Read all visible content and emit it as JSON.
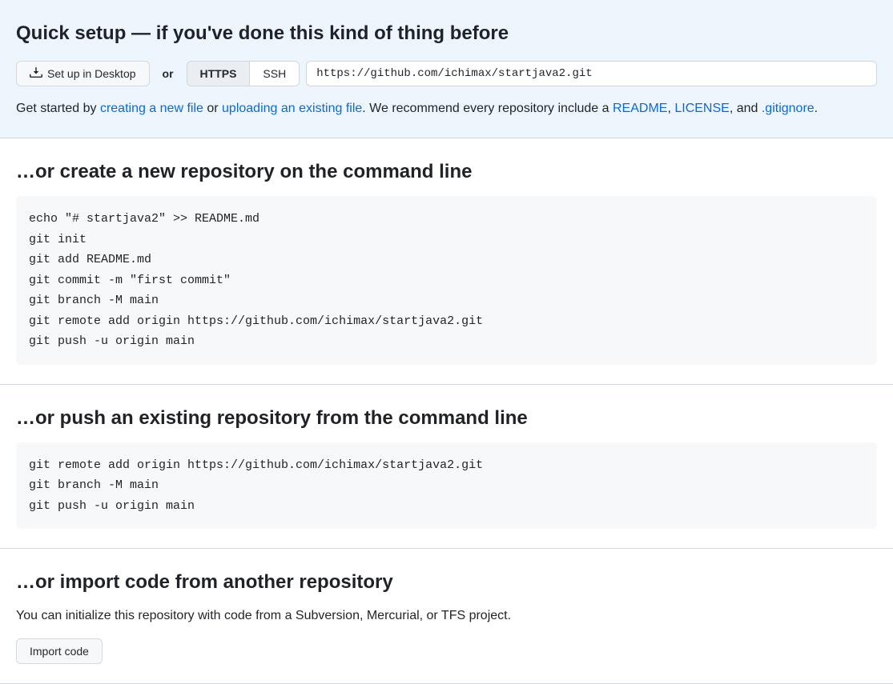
{
  "quickSetup": {
    "title": "Quick setup — if you've done this kind of thing before",
    "desktopBtn": "Set up in Desktop",
    "or": "or",
    "protocols": {
      "https": "HTTPS",
      "ssh": "SSH"
    },
    "cloneUrl": "https://github.com/ichimax/startjava2.git",
    "intro": {
      "lead": "Get started by ",
      "newFile": "creating a new file",
      "or": " or ",
      "upload": "uploading an existing file",
      "recommend": ". We recommend every repository include a ",
      "readme": "README",
      "sep1": ", ",
      "license": "LICENSE",
      "sep2": ", and ",
      "gitignore": ".gitignore",
      "end": "."
    }
  },
  "createRepo": {
    "heading": "…or create a new repository on the command line",
    "code": "echo \"# startjava2\" >> README.md\ngit init\ngit add README.md\ngit commit -m \"first commit\"\ngit branch -M main\ngit remote add origin https://github.com/ichimax/startjava2.git\ngit push -u origin main"
  },
  "pushExisting": {
    "heading": "…or push an existing repository from the command line",
    "code": "git remote add origin https://github.com/ichimax/startjava2.git\ngit branch -M main\ngit push -u origin main"
  },
  "importCode": {
    "heading": "…or import code from another repository",
    "text": "You can initialize this repository with code from a Subversion, Mercurial, or TFS project.",
    "btn": "Import code"
  }
}
